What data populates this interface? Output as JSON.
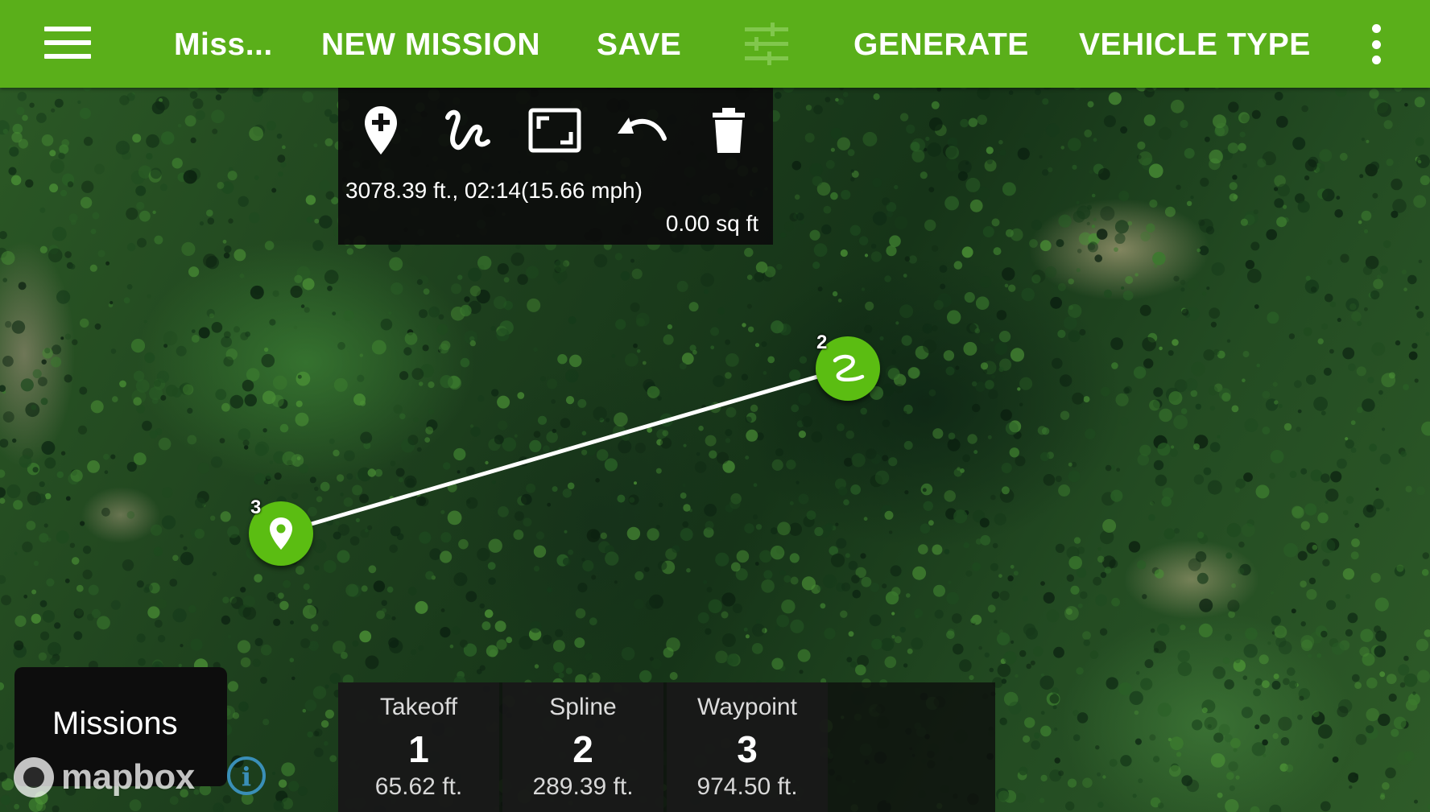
{
  "toolbar": {
    "menu_icon": "hamburger-menu-icon",
    "mission_name": "Miss...",
    "new_mission_label": "NEW MISSION",
    "save_label": "SAVE",
    "tune_icon": "tune-sliders-icon",
    "generate_label": "GENERATE",
    "vehicle_type_label": "VEHICLE TYPE",
    "overflow_icon": "more-vertical-icon",
    "bar_color": "#5aaf1a"
  },
  "tools": {
    "add_waypoint_icon": "add-location-icon",
    "spline_icon": "spline-draw-icon",
    "fit_icon": "fit-screen-icon",
    "undo_icon": "undo-icon",
    "delete_icon": "trash-icon",
    "stats": "3078.39 ft., 02:14(15.66 mph)",
    "area": "0.00 sq ft"
  },
  "map": {
    "markers": [
      {
        "number": "2",
        "kind": "spline"
      },
      {
        "number": "3",
        "kind": "waypoint"
      }
    ],
    "route_color": "#ffffff",
    "marker_color": "#5bbd12",
    "attribution": "mapbox",
    "info_symbol": "i"
  },
  "missions_button": {
    "label": "Missions"
  },
  "waypoints": [
    {
      "type": "Takeoff",
      "number": "1",
      "altitude": "65.62 ft."
    },
    {
      "type": "Spline",
      "number": "2",
      "altitude": "289.39 ft."
    },
    {
      "type": "Waypoint",
      "number": "3",
      "altitude": "974.50 ft."
    }
  ]
}
